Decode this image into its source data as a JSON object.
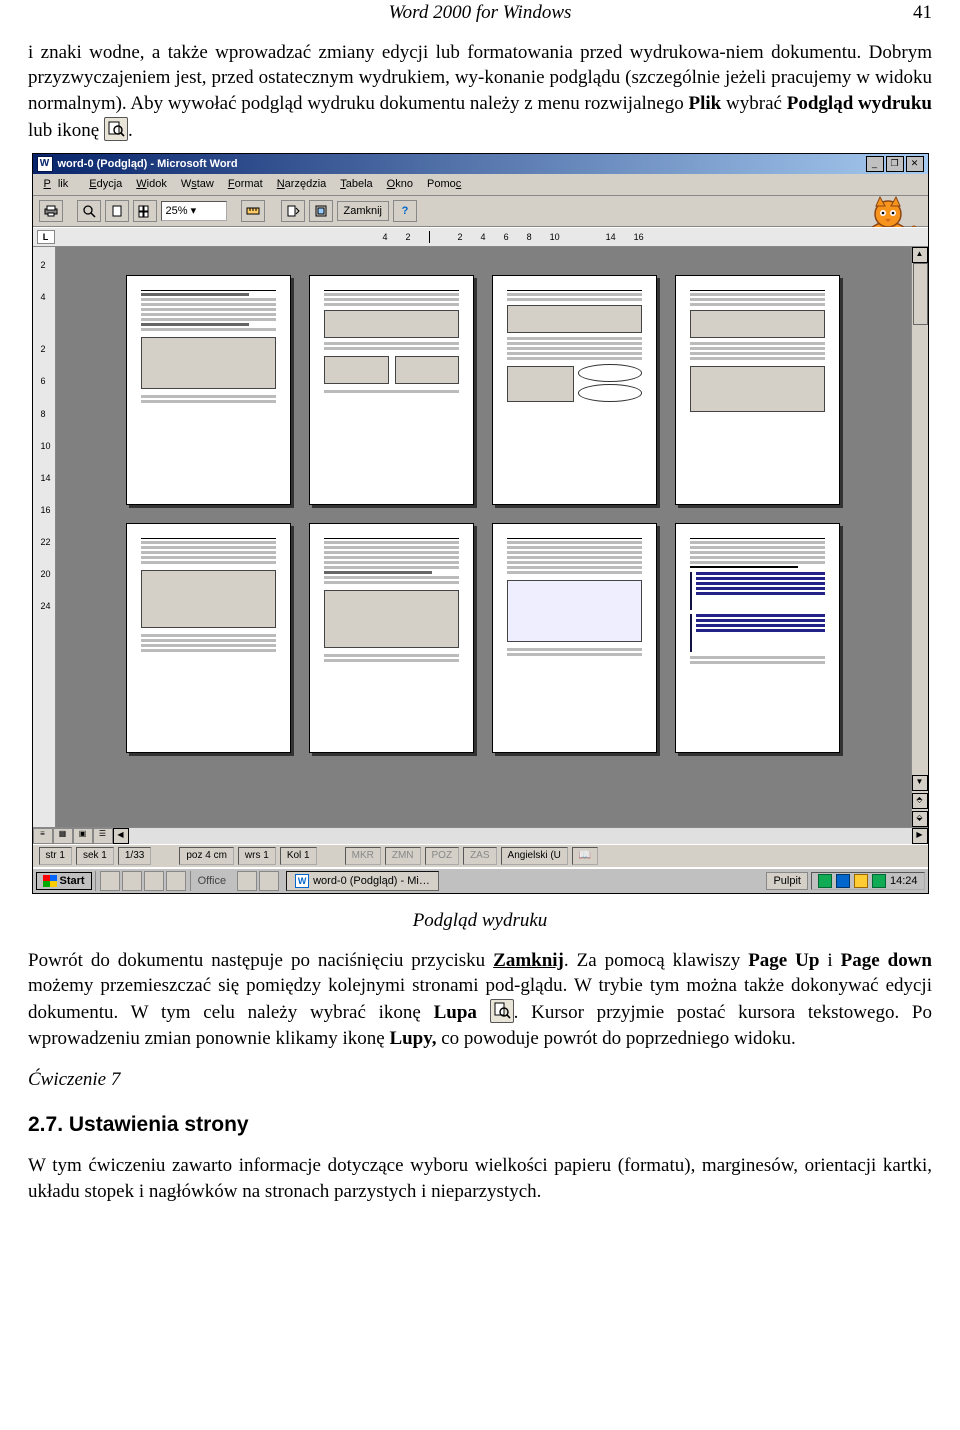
{
  "header": {
    "title": "Word 2000 for Windows",
    "page_number": "41"
  },
  "para1_a": "i znaki wodne, a także wprowadzać zmiany edycji lub formatowania przed wydrukowa-niem dokumentu. Dobrym przyzwyczajeniem jest, przed ostatecznym wydrukiem, wy-konanie podglądu (szczególnie jeżeli pracujemy w widoku normalnym). Aby wywołać podgląd wydruku dokumentu należy z menu rozwijalnego ",
  "para1_b": "Plik",
  "para1_c": " wybrać ",
  "para1_d": "Podgląd wydruku",
  "para1_e": " lub ikonę ",
  "para1_f": ".",
  "screenshot": {
    "title": "word-0 (Podgląd) - Microsoft Word",
    "menus": [
      "Plik",
      "Edycja",
      "Widok",
      "Wstaw",
      "Format",
      "Narzędzia",
      "Tabela",
      "Okno",
      "Pomoc"
    ],
    "zoom": "25%",
    "close_btn": "Zamknij",
    "ruler_h": [
      "4",
      "2",
      "2",
      "4",
      "6",
      "8",
      "10",
      "14",
      "16"
    ],
    "ruler_v": [
      "2",
      "4",
      "2",
      "6",
      "8",
      "10",
      "14",
      "16",
      "22",
      "20",
      "24"
    ],
    "status": {
      "str": "str 1",
      "sek": "sek 1",
      "pages": "1/33",
      "poz": "poz 4 cm",
      "wrs": "wrs 1",
      "kol": "Kol 1",
      "mkr": "MKR",
      "zmn": "ZMN",
      "poz2": "POZ",
      "zas": "ZAS",
      "lang": "Angielski (U"
    },
    "taskbar": {
      "start": "Start",
      "office": "Office",
      "task": "word-0 (Podgląd) - Mi…",
      "pulpit": "Pulpit",
      "clock": "14:24"
    }
  },
  "figure_caption": "Podgląd wydruku",
  "para2": {
    "a": "Powrót do dokumentu następuje po naciśnięciu przycisku ",
    "zamknij": "Zamknij",
    "b": ". Za pomocą klawiszy ",
    "pgup": "Page Up",
    "c": " i ",
    "pgdn": "Page down",
    "d": " możemy przemieszczać się pomiędzy kolejnymi stronami pod-glądu. W trybie tym można także dokonywać edycji dokumentu. W tym celu należy wybrać ikonę ",
    "lupa": "Lupa",
    "e": " ",
    "f": ". Kursor przyjmie postać kursora tekstowego. Po wprowadzeniu zmian ponownie klikamy ikonę ",
    "lupy": "Lupy,",
    "g": " co powoduje powrót do poprzedniego widoku."
  },
  "exercise7": "Ćwiczenie 7",
  "section27": "2.7. Ustawienia strony",
  "para3": "W tym ćwiczeniu zawarto informacje dotyczące wyboru wielkości papieru (formatu), marginesów, orientacji kartki, układu stopek i nagłówków na stronach parzystych i nieparzystych."
}
